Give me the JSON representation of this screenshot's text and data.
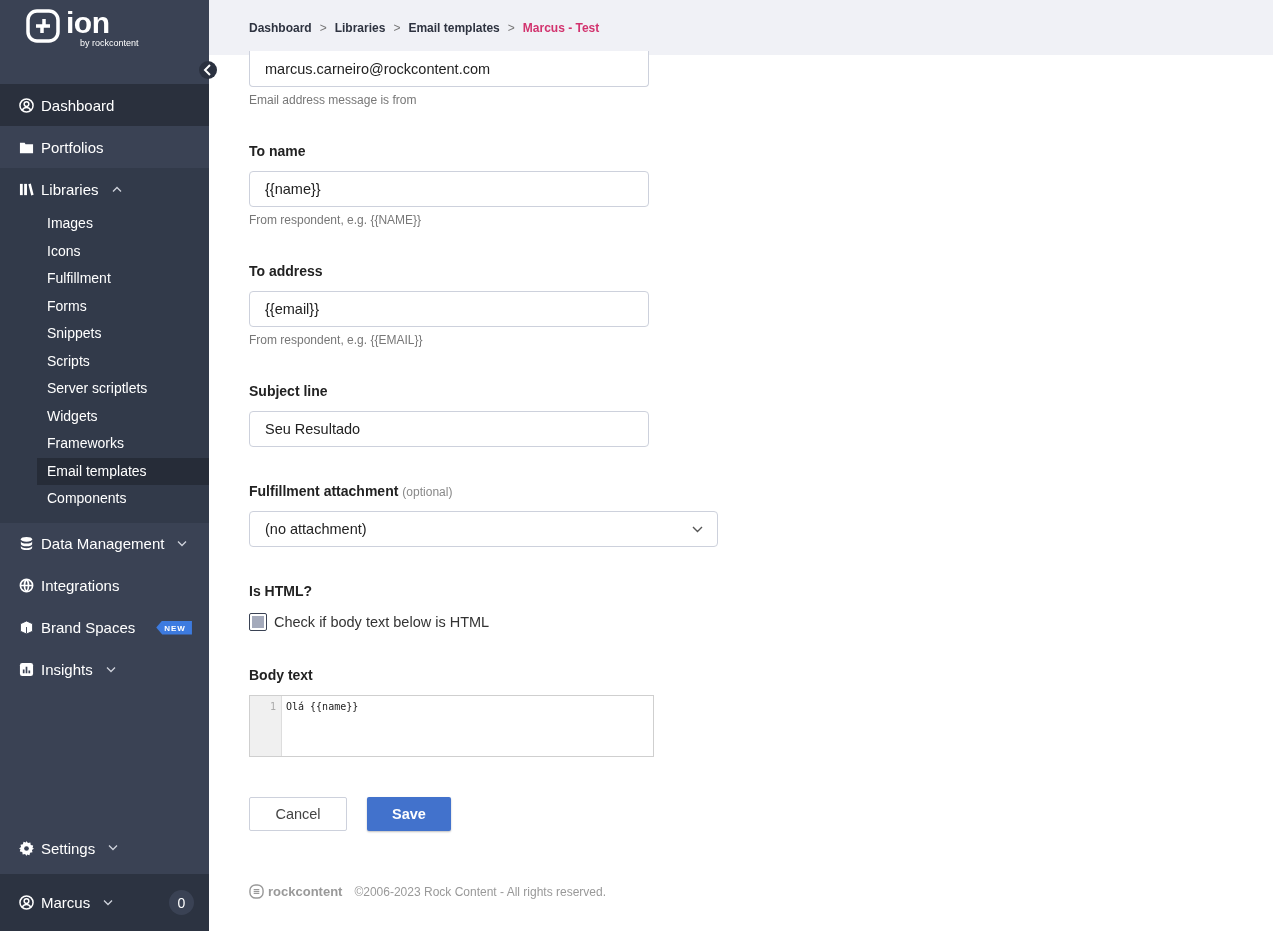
{
  "sidebar": {
    "logo": {
      "name": "ion",
      "byline": "by rockcontent"
    },
    "items": [
      {
        "label": "Dashboard",
        "selected": true
      },
      {
        "label": "Portfolios",
        "selected": false
      },
      {
        "label": "Libraries",
        "selected": false,
        "expanded": true,
        "children": [
          {
            "label": "Images",
            "selected": false
          },
          {
            "label": "Icons",
            "selected": false
          },
          {
            "label": "Fulfillment",
            "selected": false
          },
          {
            "label": "Forms",
            "selected": false
          },
          {
            "label": "Snippets",
            "selected": false
          },
          {
            "label": "Scripts",
            "selected": false
          },
          {
            "label": "Server scriptlets",
            "selected": false
          },
          {
            "label": "Widgets",
            "selected": false
          },
          {
            "label": "Frameworks",
            "selected": false
          },
          {
            "label": "Email templates",
            "selected": true
          },
          {
            "label": "Components",
            "selected": false
          }
        ]
      },
      {
        "label": "Data Management",
        "selected": false,
        "expanded": false
      },
      {
        "label": "Integrations",
        "selected": false
      },
      {
        "label": "Brand Spaces",
        "selected": false,
        "badge": "NEW"
      },
      {
        "label": "Insights",
        "selected": false,
        "expanded": false
      }
    ],
    "settings": {
      "label": "Settings",
      "expanded": false
    },
    "user": {
      "name": "Marcus",
      "expanded": false,
      "count": "0"
    }
  },
  "breadcrumb": {
    "separator": ">",
    "items": [
      "Dashboard",
      "Libraries",
      "Email templates",
      "Marcus - Test"
    ]
  },
  "fields": [
    {
      "kind": "text",
      "value": "marcus.carneiro@rockcontent.com",
      "help": "Email address message is from"
    },
    {
      "kind": "text",
      "label": "To name",
      "value": "{{name}}",
      "help": "From respondent, e.g. {{NAME}}"
    },
    {
      "kind": "text",
      "label": "To address",
      "value": "{{email}}",
      "help": "From respondent, e.g. {{EMAIL}}"
    },
    {
      "kind": "text",
      "label": "Subject line",
      "value": "Seu Resultado"
    },
    {
      "kind": "select",
      "label": "Fulfillment attachment",
      "note": "(optional)",
      "value": "(no attachment)"
    },
    {
      "kind": "checkbox",
      "label": "Is HTML?",
      "text": "Check if body text below is HTML",
      "checked": false
    },
    {
      "kind": "code",
      "label": "Body text",
      "lines": [
        {
          "number": "1",
          "text": "Olá {{name}}"
        }
      ]
    }
  ],
  "buttons": {
    "cancel": "Cancel",
    "save": "Save"
  },
  "footer": {
    "brand": "rockcontent",
    "copyright": "©2006-2023 Rock Content - All rights reserved."
  }
}
